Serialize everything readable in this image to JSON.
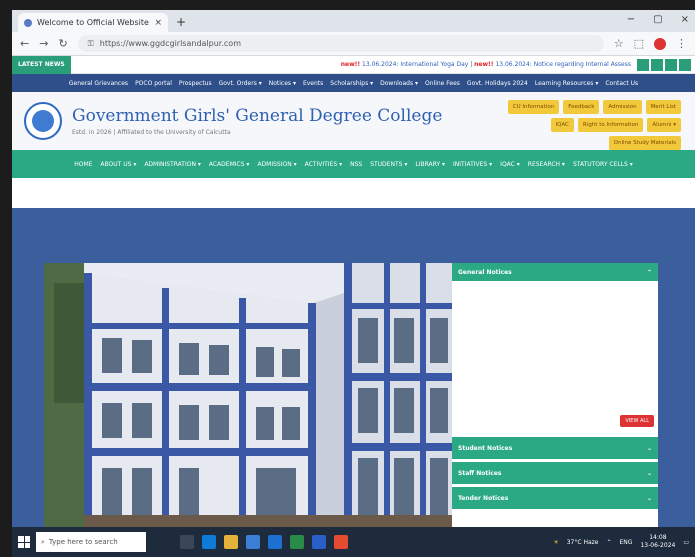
{
  "browser": {
    "tab_title": "Welcome to Official Website o",
    "tab_close": "×",
    "new_tab": "+",
    "window_controls": [
      "−",
      "▢",
      "×"
    ],
    "url": "https://www.ggdcgirlsandalpur.com"
  },
  "ticker": {
    "latest_label": "LATEST NEWS",
    "new_tag": "new!!",
    "items": [
      "13.06.2024: International Yoga Day",
      "13.06.2024: Notice regarding Internal Assess"
    ]
  },
  "topnav": [
    "General Grievances",
    "POCO portal",
    "Prospectus",
    "Govt. Orders ▾",
    "Notices ▾",
    "Events",
    "Scholarships ▾",
    "Downloads ▾",
    "Online Fees",
    "Govt. Holidays 2024",
    "Learning Resources ▾",
    "Contact Us"
  ],
  "header": {
    "title": "Government Girls' General Degree College",
    "subtitle": "Estd. in 2026 | Affiliated to the University of Calcutta",
    "quick_links": [
      "CU Information",
      "Feedback",
      "Admission",
      "Merit List",
      "IQAC",
      "Right to Information",
      "Alumni ▾",
      "Online Study Materials"
    ]
  },
  "mainnav": [
    "HOME",
    "ABOUT US ▾",
    "ADMINISTRATION ▾",
    "ACADEMICS ▾",
    "ADMISSION ▾",
    "ACTIVITIES ▾",
    "NSS",
    "STUDENTS ▾",
    "LIBRARY ▾",
    "INITIATIVES ▾",
    "IQAC ▾",
    "RESEARCH ▾",
    "STATUTORY CELLS ▾"
  ],
  "notices": {
    "general": "General Notices",
    "view_all": "VIEW ALL",
    "student": "Student Notices",
    "staff": "Staff Notices",
    "tender": "Tender Notices"
  },
  "taskbar": {
    "search_placeholder": "Type here to search",
    "weather": "37°C Haze",
    "lang": "ENG",
    "time": "14:08",
    "date": "13-06-2024"
  },
  "colors": {
    "accent_green": "#2ba985",
    "nav_blue": "#2e4f8a",
    "quick_link_yellow": "#f3c93c"
  }
}
